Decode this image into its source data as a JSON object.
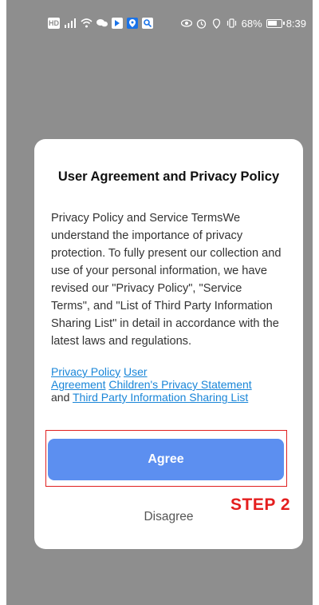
{
  "status_bar": {
    "battery": "68%",
    "time": "8:39",
    "icons": [
      "hd-icon",
      "signal-icon",
      "wifi-icon",
      "chat-icon",
      "app-icon",
      "location-icon",
      "app-search-icon",
      "eye-icon",
      "alarm-icon",
      "location-pin-icon",
      "vibrate-icon",
      "battery-icon"
    ]
  },
  "dialog": {
    "title": "User Agreement and Privacy Policy",
    "body": "Privacy Policy and Service TermsWe understand the importance of privacy protection. To fully present our collection and use of your personal information, we have revised our \"Privacy Policy\", \"Service Terms\", and \"List of Third Party Information Sharing List\" in detail in accordance with the latest laws and regulations.",
    "links": {
      "privacy_policy": "Privacy Policy",
      "user_agreement_1": "User",
      "user_agreement_2": "Agreement",
      "childrens_privacy": "Children's Privacy Statement",
      "and": "and",
      "third_party": "Third Party Information Sharing List"
    },
    "agree_label": "Agree",
    "disagree_label": "Disagree"
  },
  "annotation": {
    "step_label": "STEP 2",
    "frame_color": "#e02020"
  },
  "colors": {
    "backdrop": "#8e8e8e",
    "primary_button": "#5c8ff0",
    "link": "#1a86d8",
    "annotation_red": "#e41e1e"
  }
}
